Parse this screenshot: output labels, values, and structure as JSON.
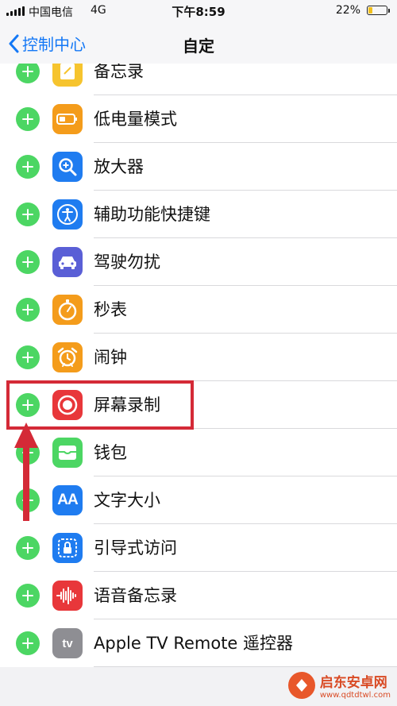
{
  "status_bar": {
    "carrier": "中国电信",
    "network": "4G",
    "time": "下午8:59",
    "battery_percent": "22%",
    "battery_level": 0.22
  },
  "nav": {
    "back_label": "控制中心",
    "title": "自定"
  },
  "items": [
    {
      "label": "备忘录",
      "icon": "notes-icon"
    },
    {
      "label": "低电量模式",
      "icon": "low-power-icon"
    },
    {
      "label": "放大器",
      "icon": "magnifier-icon"
    },
    {
      "label": "辅助功能快捷键",
      "icon": "accessibility-icon"
    },
    {
      "label": "驾驶勿扰",
      "icon": "car-icon"
    },
    {
      "label": "秒表",
      "icon": "stopwatch-icon"
    },
    {
      "label": "闹钟",
      "icon": "alarm-icon"
    },
    {
      "label": "屏幕录制",
      "icon": "screen-record-icon"
    },
    {
      "label": "钱包",
      "icon": "wallet-icon"
    },
    {
      "label": "文字大小",
      "icon": "text-size-icon"
    },
    {
      "label": "引导式访问",
      "icon": "guided-access-icon"
    },
    {
      "label": "语音备忘录",
      "icon": "voice-memo-icon"
    },
    {
      "label": "Apple TV Remote 遥控器",
      "icon": "apple-tv-remote-icon"
    }
  ],
  "icon_glyphs": {
    "text_size": "AA",
    "apple_tv": "tv"
  },
  "colors": {
    "accent": "#1478f6",
    "add_green": "#4cd663",
    "annotation_red": "#d42a37"
  },
  "watermark": {
    "name": "启东安卓网",
    "url": "www.qdtdtwl.com"
  }
}
